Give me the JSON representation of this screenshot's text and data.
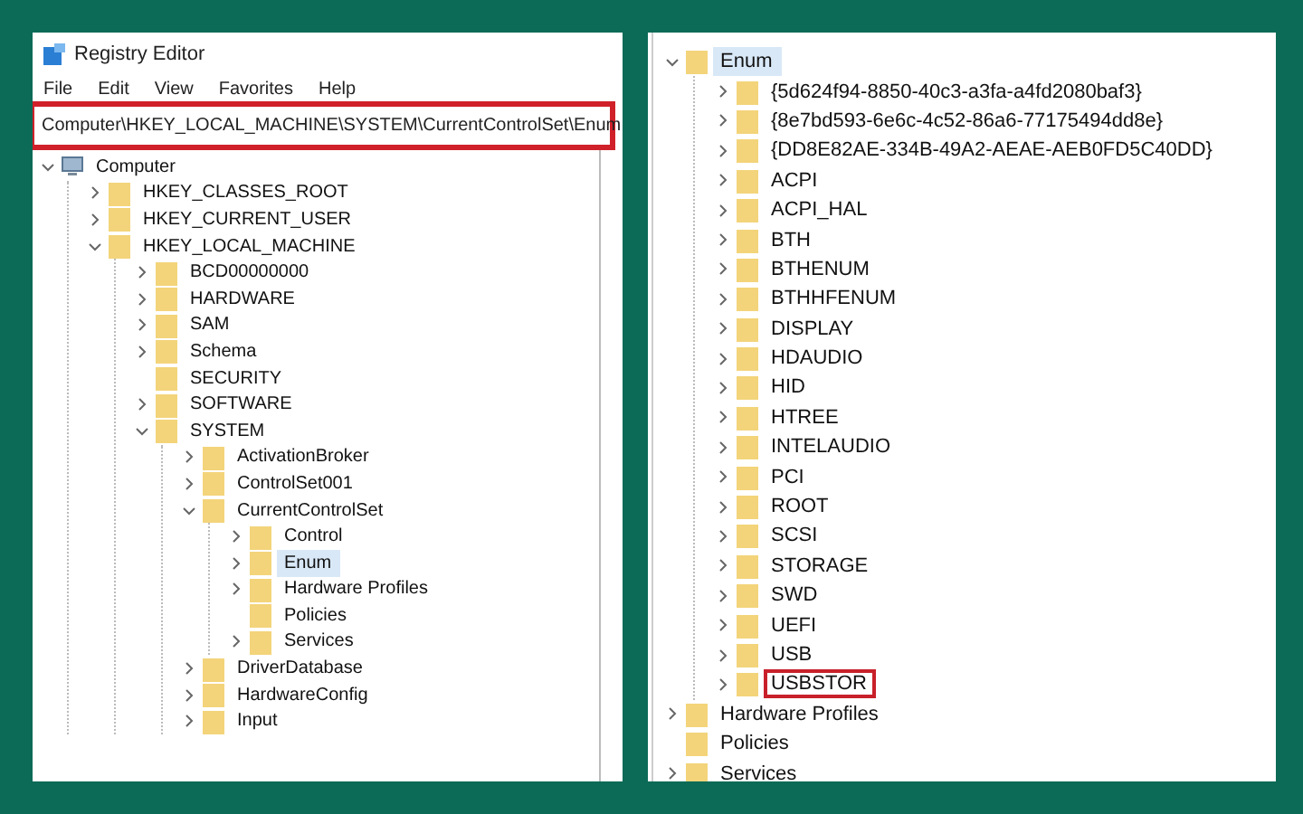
{
  "left_window": {
    "title": "Registry Editor",
    "menu": [
      "File",
      "Edit",
      "View",
      "Favorites",
      "Help"
    ],
    "address": {
      "value": "Computer\\HKEY_LOCAL_MACHINE\\SYSTEM\\CurrentControlSet\\Enum",
      "highlighted": true
    },
    "tree": [
      {
        "label": "Computer",
        "kind": "computer",
        "expanded": true,
        "selected": false,
        "highlighted": false,
        "children": [
          {
            "label": "HKEY_CLASSES_ROOT",
            "kind": "branch",
            "expanded": false,
            "selected": false,
            "highlighted": false
          },
          {
            "label": "HKEY_CURRENT_USER",
            "kind": "branch",
            "expanded": false,
            "selected": false,
            "highlighted": false
          },
          {
            "label": "HKEY_LOCAL_MACHINE",
            "kind": "branch",
            "expanded": true,
            "selected": false,
            "highlighted": false,
            "children": [
              {
                "label": "BCD00000000",
                "kind": "branch",
                "expanded": false,
                "selected": false,
                "highlighted": false
              },
              {
                "label": "HARDWARE",
                "kind": "branch",
                "expanded": false,
                "selected": false,
                "highlighted": false
              },
              {
                "label": "SAM",
                "kind": "branch",
                "expanded": false,
                "selected": false,
                "highlighted": false
              },
              {
                "label": "Schema",
                "kind": "branch",
                "expanded": false,
                "selected": false,
                "highlighted": false
              },
              {
                "label": "SECURITY",
                "kind": "leaf",
                "selected": false,
                "highlighted": false
              },
              {
                "label": "SOFTWARE",
                "kind": "branch",
                "expanded": false,
                "selected": false,
                "highlighted": false
              },
              {
                "label": "SYSTEM",
                "kind": "branch",
                "expanded": true,
                "selected": false,
                "highlighted": false,
                "children": [
                  {
                    "label": "ActivationBroker",
                    "kind": "branch",
                    "expanded": false,
                    "selected": false,
                    "highlighted": false
                  },
                  {
                    "label": "ControlSet001",
                    "kind": "branch",
                    "expanded": false,
                    "selected": false,
                    "highlighted": false
                  },
                  {
                    "label": "CurrentControlSet",
                    "kind": "branch",
                    "expanded": true,
                    "selected": false,
                    "highlighted": false,
                    "children": [
                      {
                        "label": "Control",
                        "kind": "branch",
                        "expanded": false,
                        "selected": false,
                        "highlighted": false
                      },
                      {
                        "label": "Enum",
                        "kind": "branch",
                        "expanded": false,
                        "selected": true,
                        "highlighted": false
                      },
                      {
                        "label": "Hardware Profiles",
                        "kind": "branch",
                        "expanded": false,
                        "selected": false,
                        "highlighted": false
                      },
                      {
                        "label": "Policies",
                        "kind": "leaf",
                        "selected": false,
                        "highlighted": false
                      },
                      {
                        "label": "Services",
                        "kind": "branch",
                        "expanded": false,
                        "selected": false,
                        "highlighted": false
                      }
                    ]
                  },
                  {
                    "label": "DriverDatabase",
                    "kind": "branch",
                    "expanded": false,
                    "selected": false,
                    "highlighted": false
                  },
                  {
                    "label": "HardwareConfig",
                    "kind": "branch",
                    "expanded": false,
                    "selected": false,
                    "highlighted": false
                  },
                  {
                    "label": "Input",
                    "kind": "branch",
                    "expanded": false,
                    "selected": false,
                    "highlighted": false
                  }
                ]
              }
            ]
          }
        ]
      }
    ]
  },
  "right_window": {
    "tree": [
      {
        "label": "Enum",
        "kind": "branch",
        "expanded": true,
        "selected": true,
        "highlighted": false,
        "children": [
          {
            "label": "{5d624f94-8850-40c3-a3fa-a4fd2080baf3}",
            "kind": "branch",
            "expanded": false,
            "selected": false,
            "highlighted": false
          },
          {
            "label": "{8e7bd593-6e6c-4c52-86a6-77175494dd8e}",
            "kind": "branch",
            "expanded": false,
            "selected": false,
            "highlighted": false
          },
          {
            "label": "{DD8E82AE-334B-49A2-AEAE-AEB0FD5C40DD}",
            "kind": "branch",
            "expanded": false,
            "selected": false,
            "highlighted": false
          },
          {
            "label": "ACPI",
            "kind": "branch",
            "expanded": false,
            "selected": false,
            "highlighted": false
          },
          {
            "label": "ACPI_HAL",
            "kind": "branch",
            "expanded": false,
            "selected": false,
            "highlighted": false
          },
          {
            "label": "BTH",
            "kind": "branch",
            "expanded": false,
            "selected": false,
            "highlighted": false
          },
          {
            "label": "BTHENUM",
            "kind": "branch",
            "expanded": false,
            "selected": false,
            "highlighted": false
          },
          {
            "label": "BTHHFENUM",
            "kind": "branch",
            "expanded": false,
            "selected": false,
            "highlighted": false
          },
          {
            "label": "DISPLAY",
            "kind": "branch",
            "expanded": false,
            "selected": false,
            "highlighted": false
          },
          {
            "label": "HDAUDIO",
            "kind": "branch",
            "expanded": false,
            "selected": false,
            "highlighted": false
          },
          {
            "label": "HID",
            "kind": "branch",
            "expanded": false,
            "selected": false,
            "highlighted": false
          },
          {
            "label": "HTREE",
            "kind": "branch",
            "expanded": false,
            "selected": false,
            "highlighted": false
          },
          {
            "label": "INTELAUDIO",
            "kind": "branch",
            "expanded": false,
            "selected": false,
            "highlighted": false
          },
          {
            "label": "PCI",
            "kind": "branch",
            "expanded": false,
            "selected": false,
            "highlighted": false
          },
          {
            "label": "ROOT",
            "kind": "branch",
            "expanded": false,
            "selected": false,
            "highlighted": false
          },
          {
            "label": "SCSI",
            "kind": "branch",
            "expanded": false,
            "selected": false,
            "highlighted": false
          },
          {
            "label": "STORAGE",
            "kind": "branch",
            "expanded": false,
            "selected": false,
            "highlighted": false
          },
          {
            "label": "SWD",
            "kind": "branch",
            "expanded": false,
            "selected": false,
            "highlighted": false
          },
          {
            "label": "UEFI",
            "kind": "branch",
            "expanded": false,
            "selected": false,
            "highlighted": false
          },
          {
            "label": "USB",
            "kind": "branch",
            "expanded": false,
            "selected": false,
            "highlighted": false
          },
          {
            "label": "USBSTOR",
            "kind": "branch",
            "expanded": false,
            "selected": false,
            "highlighted": true
          }
        ]
      },
      {
        "label": "Hardware Profiles",
        "kind": "branch",
        "expanded": false,
        "selected": false,
        "highlighted": false
      },
      {
        "label": "Policies",
        "kind": "leaf",
        "selected": false,
        "highlighted": false
      },
      {
        "label": "Services",
        "kind": "branch",
        "expanded": false,
        "selected": false,
        "highlighted": false
      }
    ]
  }
}
